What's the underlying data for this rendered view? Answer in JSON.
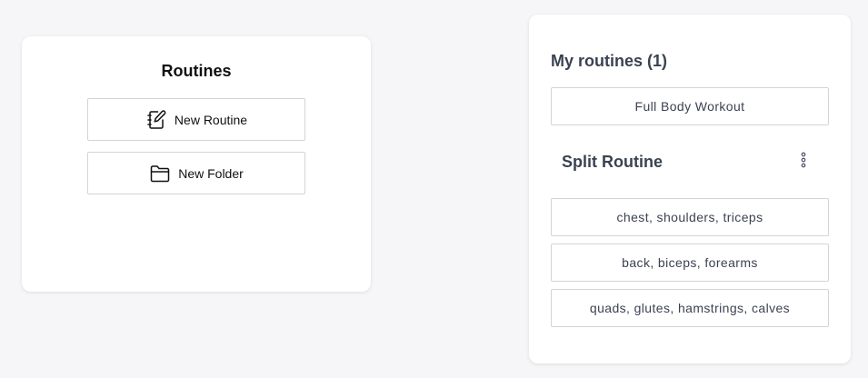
{
  "routines_panel": {
    "title": "Routines",
    "new_routine_label": "New Routine",
    "new_folder_label": "New Folder"
  },
  "my_routines": {
    "title": "My routines (1)",
    "items": [
      {
        "label": "Full Body Workout"
      }
    ],
    "folders": [
      {
        "name": "Split Routine",
        "items": [
          {
            "label": "chest, shoulders, triceps"
          },
          {
            "label": "back, biceps, forearms"
          },
          {
            "label": "quads, glutes, hamstrings, calves"
          }
        ]
      }
    ]
  },
  "icons": {
    "new_routine": "notebook-pen-icon",
    "new_folder": "folder-icon",
    "menu": "vertical-dots-icon"
  },
  "colors": {
    "background": "#f6f6f8",
    "card": "#ffffff",
    "border": "#d4d4d8",
    "text_dark": "#111111",
    "text_slate": "#3b4252"
  }
}
